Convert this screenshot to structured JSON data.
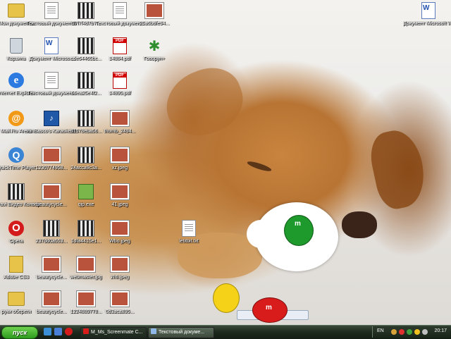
{
  "desktop": {
    "icons": [
      {
        "label": "Мои документы",
        "icon": "my-documents-icon"
      },
      {
        "label": "Текстовый документ.txt",
        "icon": "text-file-icon"
      },
      {
        "label": "07f7f4d7b7...",
        "icon": "video-file-icon"
      },
      {
        "label": "Текстовый докумен...",
        "icon": "text-file-icon"
      },
      {
        "label": "25a6bdfe94...",
        "icon": "image-file-icon"
      },
      {
        "label": "Корзина",
        "icon": "recycle-bin-icon"
      },
      {
        "label": "Документ Microso...",
        "icon": "word-document-icon"
      },
      {
        "label": "cde64465bc...",
        "icon": "video-file-icon"
      },
      {
        "label": "14884.pdf",
        "icon": "pdf-file-icon"
      },
      {
        "label": "Говорун+",
        "icon": "gear-app-icon"
      },
      {
        "label": "Internet Explorer",
        "icon": "internet-explorer-icon"
      },
      {
        "label": "Текстовый докумен...",
        "icon": "text-file-icon"
      },
      {
        "label": "66ea25e4f2...",
        "icon": "video-file-icon"
      },
      {
        "label": "14895.pdf",
        "icon": "pdf-file-icon"
      },
      {
        "label": "Mail.Ru Агент",
        "icon": "mail-agent-icon"
      },
      {
        "label": "vanBasco's Karaoke Player",
        "icon": "karaoke-player-icon"
      },
      {
        "label": "d1678eba56...",
        "icon": "video-file-icon"
      },
      {
        "label": "thumb_2494...",
        "icon": "image-file-icon"
      },
      {
        "label": "QuickTime Player",
        "icon": "quicktime-icon"
      },
      {
        "label": "1230774958...",
        "icon": "image-file-icon"
      },
      {
        "label": "24acca9c3a...",
        "icon": "video-file-icon"
      },
      {
        "label": "xz.jpeg",
        "icon": "image-file-icon"
      },
      {
        "label": "Movavi Видео Конвертер 9.0",
        "icon": "movavi-icon"
      },
      {
        "label": "beautycycle...",
        "icon": "image-file-icon"
      },
      {
        "label": "qip.exe",
        "icon": "exe-file-icon"
      },
      {
        "label": "41.jpeg",
        "icon": "image-file-icon"
      },
      {
        "label": "Opera",
        "icon": "opera-icon"
      },
      {
        "label": "237dd0a553...",
        "icon": "video-file-icon"
      },
      {
        "label": "1dfa4415e1...",
        "icon": "video-file-icon"
      },
      {
        "label": "Wbo.jpeg",
        "icon": "image-file-icon"
      },
      {
        "label": "letitbit.txt",
        "icon": "text-file-icon"
      },
      {
        "label": "Adobe CS3",
        "icon": "adobe-folder-icon"
      },
      {
        "label": "beautycycle...",
        "icon": "image-file-icon"
      },
      {
        "label": "webmaster.jpg",
        "icon": "image-file-icon"
      },
      {
        "label": "zhti.jpeg",
        "icon": "image-file-icon"
      },
      {
        "label": "руки обереги",
        "icon": "folder-icon"
      },
      {
        "label": "beautycycle...",
        "icon": "image-file-icon"
      },
      {
        "label": "1224889778...",
        "icon": "image-file-icon"
      },
      {
        "label": "0d3aca895...",
        "icon": "image-file-icon"
      },
      {
        "label": "Документ Microsoft W...",
        "icon": "word-document-icon"
      }
    ]
  },
  "taskbar": {
    "start_label": "пуск",
    "quick_launch": [
      "show-desktop-icon",
      "internet-explorer-icon",
      "opera-icon"
    ],
    "tasks": [
      {
        "label": "M_Ms_Screenmate C...",
        "icon": "screenmate-icon",
        "active": true
      },
      {
        "label": "Текстовый докуме...",
        "icon": "notepad-icon",
        "active": false
      }
    ],
    "tray": {
      "language": "EN",
      "icons": [
        "security-icon",
        "speaker-icon",
        "network-icon",
        "messenger-icon",
        "update-icon"
      ],
      "time": "20:17"
    }
  }
}
